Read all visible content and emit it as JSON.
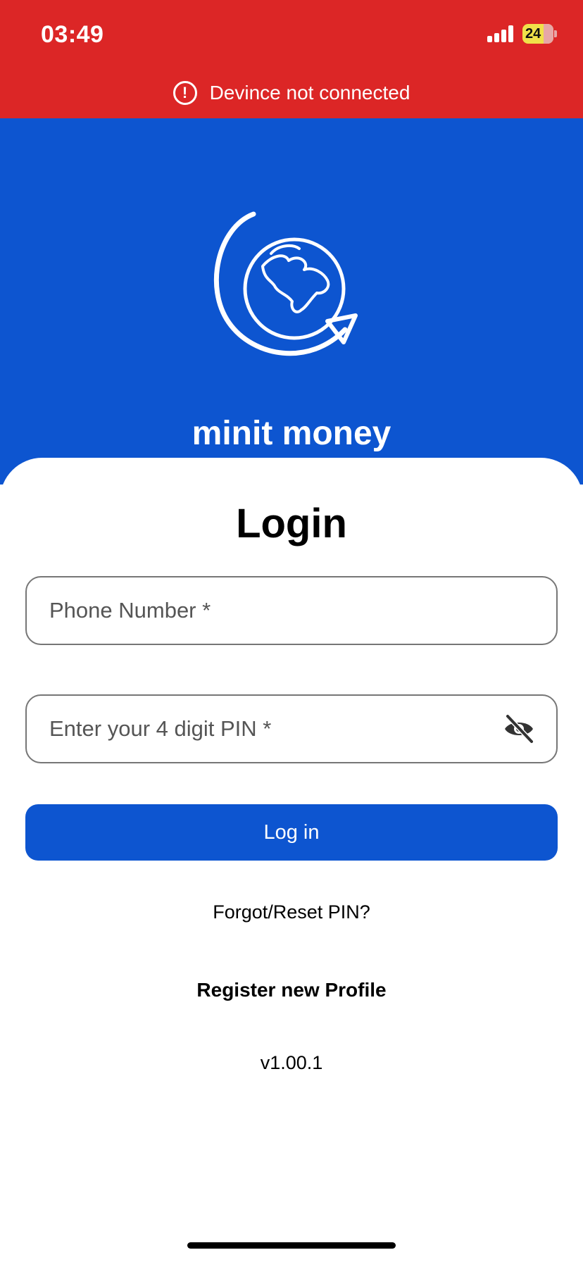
{
  "status_bar": {
    "time": "03:49",
    "battery": "24",
    "banner_text": "Devince not connected",
    "colors": {
      "background": "#dc2626"
    }
  },
  "hero": {
    "brand_name": "minit money",
    "logo_icon": "globe-arrow-icon",
    "colors": {
      "background": "#0d55d0"
    }
  },
  "login": {
    "title": "Login",
    "phone_placeholder": "Phone Number *",
    "pin_placeholder": "Enter your 4 digit PIN *",
    "pin_visibility_icon": "eye-off-icon",
    "login_label": "Log in",
    "forgot_label": "Forgot/Reset PIN?",
    "register_label": "Register new Profile",
    "version": "v1.00.1"
  }
}
